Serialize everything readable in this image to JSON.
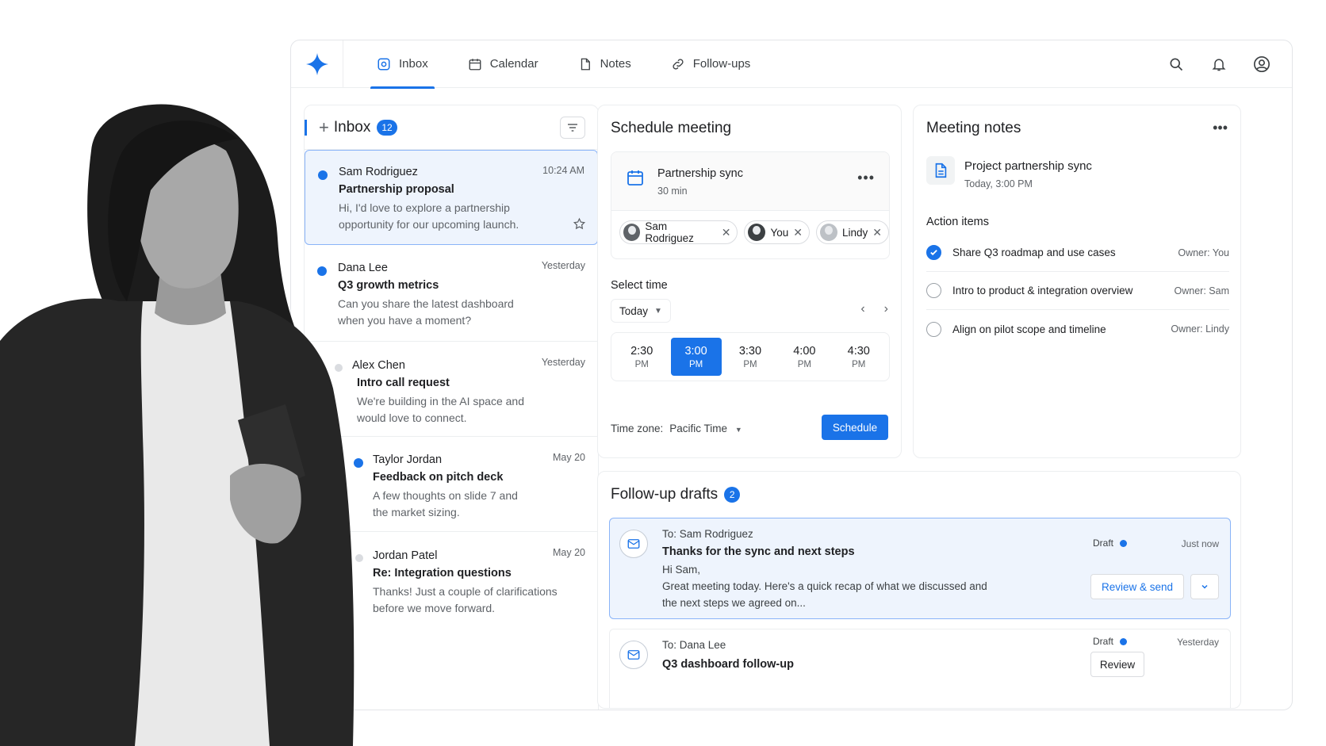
{
  "nav": {
    "tabs": [
      {
        "label": "Inbox",
        "active": true
      },
      {
        "label": "Calendar"
      },
      {
        "label": "Notes"
      },
      {
        "label": "Follow-ups"
      }
    ]
  },
  "inbox": {
    "title": "Inbox",
    "count": "12",
    "messages": [
      {
        "sender": "Sam Rodriguez",
        "subject": "Partnership proposal",
        "preview": "Hi, I'd love to explore a partnership opportunity for our upcoming launch.",
        "time": "10:24 AM",
        "unread": true,
        "selected": true
      },
      {
        "sender": "Dana Lee",
        "subject": "Q3 growth metrics",
        "preview": "Can you share the latest dashboard when you have a moment?",
        "time": "Yesterday",
        "unread": true
      },
      {
        "sender": "Alex Chen",
        "subject": "Intro call request",
        "preview": "We're building in the AI space and would love to connect.",
        "time": "Yesterday",
        "unread": false
      },
      {
        "sender": "Taylor Jordan",
        "subject": "Feedback on pitch deck",
        "preview": "A few thoughts on slide 7 and the market sizing.",
        "time": "May 20",
        "unread": true
      },
      {
        "sender": "Jordan Patel",
        "subject": "Re: Integration questions",
        "preview": "Thanks! Just a couple of clarifications before we move forward.",
        "time": "May 20",
        "unread": false
      }
    ]
  },
  "schedule": {
    "title": "Schedule meeting",
    "meeting_name": "Partnership sync",
    "duration": "30 min",
    "attendees": [
      "Sam Rodriguez",
      "You",
      "Lindy"
    ],
    "select_time_label": "Select time",
    "day": "Today",
    "slots": [
      {
        "time": "2:30",
        "ampm": "PM"
      },
      {
        "time": "3:00",
        "ampm": "PM",
        "selected": true
      },
      {
        "time": "3:30",
        "ampm": "PM"
      },
      {
        "time": "4:00",
        "ampm": "PM"
      },
      {
        "time": "4:30",
        "ampm": "PM"
      }
    ],
    "timezone_label": "Time zone:",
    "timezone_value": "Pacific Time",
    "schedule_button": "Schedule"
  },
  "notes": {
    "title": "Meeting notes",
    "doc_name": "Project partnership sync",
    "doc_time": "Today, 3:00 PM",
    "action_items_label": "Action items",
    "actions": [
      {
        "label": "Share Q3 roadmap and use cases",
        "owner": "Owner:  You",
        "done": true
      },
      {
        "label": "Intro to product & integration overview",
        "owner": "Owner:  Sam",
        "done": false
      },
      {
        "label": "Align on pilot scope and timeline",
        "owner": "Owner:  Lindy",
        "done": false
      }
    ]
  },
  "drafts": {
    "title": "Follow-up drafts",
    "count": "2",
    "items": [
      {
        "to": "To: Sam Rodriguez",
        "subject": "Thanks for the sync and next steps",
        "greeting": "Hi Sam,",
        "body": "Great meeting today. Here's a quick recap of what we discussed and the next steps we agreed on...",
        "status": "Draft",
        "when": "Just now",
        "button": "Review & send"
      },
      {
        "to": "To: Dana Lee",
        "subject": "Q3 dashboard follow-up",
        "status": "Draft",
        "when": "Yesterday",
        "button": "Review"
      }
    ]
  },
  "colors": {
    "accent": "#1a73e8",
    "border": "#eceef0",
    "text": "#202124",
    "muted": "#5f6368"
  },
  "icons": [
    "sparkle-logo-icon",
    "search-icon",
    "bell-icon",
    "account-icon",
    "filter-icon",
    "star-icon",
    "calendar-icon",
    "document-icon",
    "mail-icon"
  ]
}
